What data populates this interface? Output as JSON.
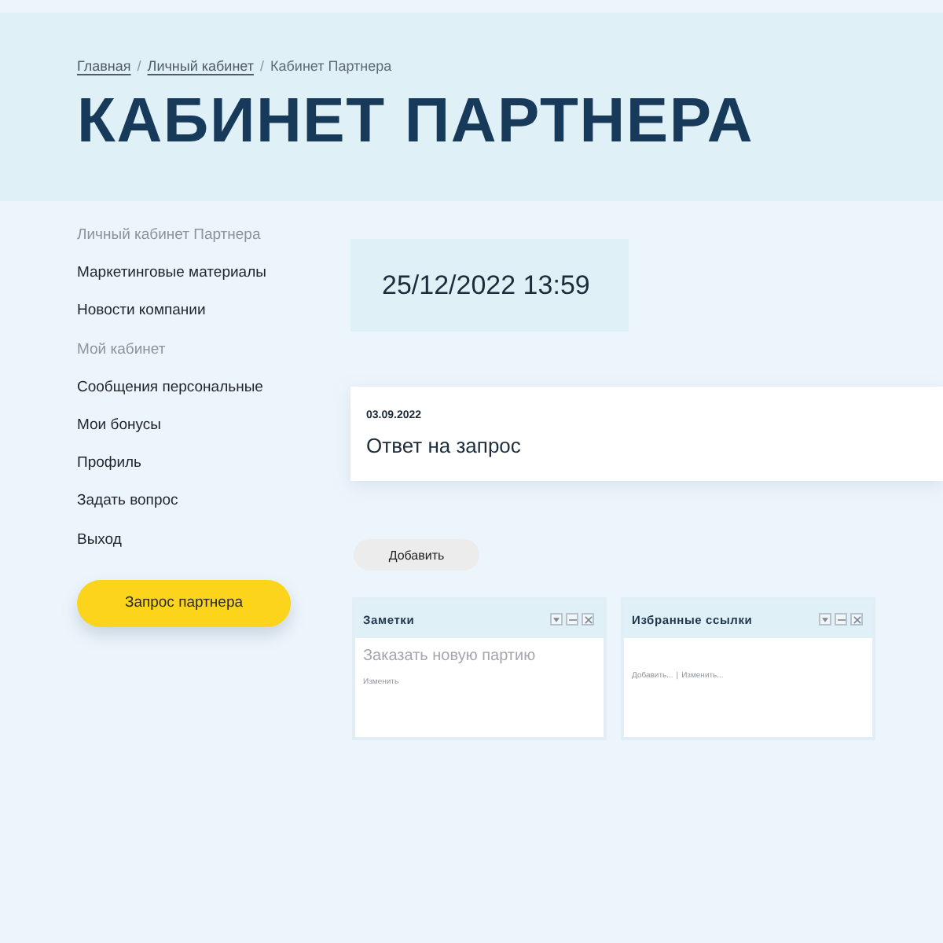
{
  "breadcrumb": {
    "separator": "/",
    "items": [
      {
        "label": "Главная",
        "kind": "link"
      },
      {
        "label": "Личный кабинет",
        "kind": "link"
      },
      {
        "label": "Кабинет Партнера",
        "kind": "current"
      }
    ]
  },
  "page_title": "КАБИНЕТ ПАРТНЕРА",
  "sidebar": {
    "items": [
      {
        "label": "Личный кабинет Партнера",
        "kind": "heading"
      },
      {
        "label": "Маркетинговые материалы",
        "kind": "link"
      },
      {
        "label": "Новости компании",
        "kind": "link"
      },
      {
        "label": "Мой кабинет",
        "kind": "heading"
      },
      {
        "label": "Сообщения персональные",
        "kind": "link"
      },
      {
        "label": "Мои бонусы",
        "kind": "link"
      },
      {
        "label": "Профиль",
        "kind": "link"
      },
      {
        "label": "Задать вопрос",
        "kind": "link"
      },
      {
        "label": "Выход",
        "kind": "link"
      }
    ],
    "button": "Запрос партнера"
  },
  "datetime": "25/12/2022 13:59",
  "news": [
    {
      "date": "03.09.2022",
      "title": "Ответ на запрос"
    }
  ],
  "add_button": "Добавить",
  "widgets": [
    {
      "title": "Заметки",
      "note": "Заказать новую партию",
      "links": [
        "Изменить"
      ]
    },
    {
      "title": "Избранные ссылки",
      "links": [
        "Добавить...",
        "Изменить..."
      ],
      "separator": "|"
    }
  ]
}
